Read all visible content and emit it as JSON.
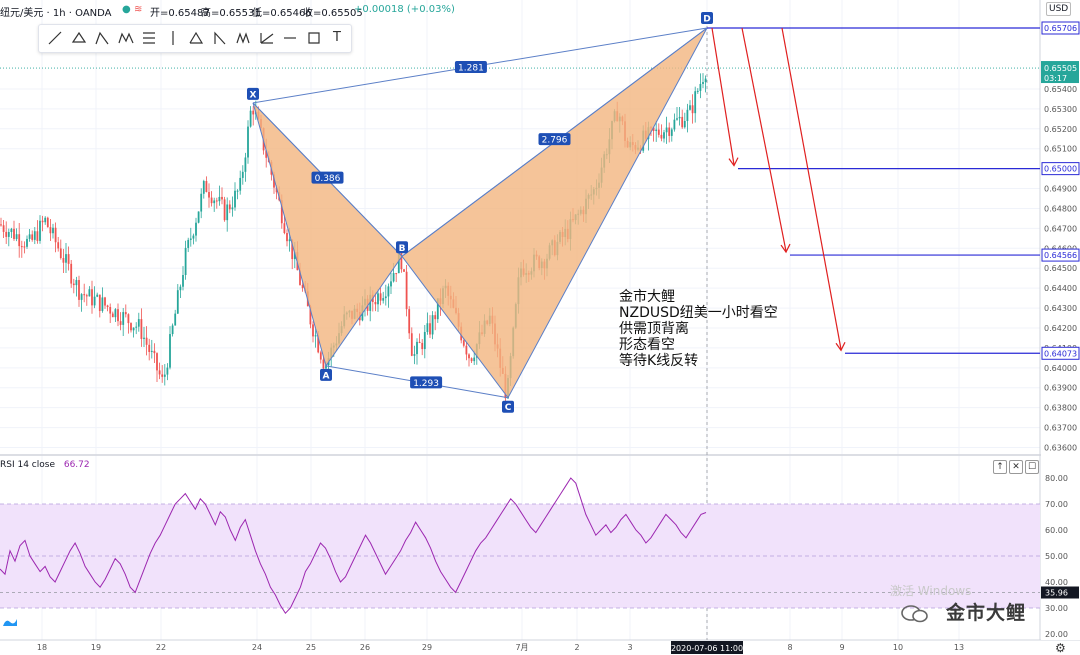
{
  "toolbar": {
    "symbol": "纽元/美元 · 1h · OANDA",
    "open": "开=0.65487",
    "high": "高=0.65531",
    "low": "低=0.65466",
    "close": "收=0.65505",
    "change": "+0.00018 (+0.03%)"
  },
  "drawing_tools": [
    "line-tool-icon",
    "channel-tool-icon",
    "triangle-pattern-icon",
    "xabcd-pattern-icon",
    "fib-tool-icon",
    "vertical-line-icon",
    "fib-extension-icon",
    "triangle-icon",
    "zigzag-icon",
    "gann-icon",
    "horizontal-ray-icon",
    "rectangle-icon",
    "text-tool-icon"
  ],
  "text_tool_label": "T",
  "currency_label": "USD",
  "annotation": {
    "lines": [
      "金市大鲤",
      "NZDUSD纽美一小时看空",
      "供需顶背离",
      "形态看空",
      "等待K线反转"
    ]
  },
  "rsi_panel": {
    "label": "RSI 14 close",
    "value": "66.72",
    "buttons": [
      "↑",
      "✕",
      "☐"
    ]
  },
  "watermark": {
    "os_text": "激活 Windows",
    "brand": "金市大鲤"
  },
  "colors": {
    "pattern_fill": "#f3b57f",
    "pattern_stroke": "#5b7fc7",
    "label_bg": "#1e4fb5",
    "target_line": "#2a2ad6",
    "arrow": "#e02020",
    "up_candle": "#26a69a",
    "down_candle": "#ef5350",
    "rsi_line": "#9c27b0",
    "rsi_band": "#f1e2fb"
  },
  "chart_data": {
    "type": "candlestick",
    "instrument": "NZDUSD",
    "timeframe": "1h",
    "price_axis": {
      "range": [
        0.6355,
        0.6585
      ],
      "ticks": [
        "0.65400",
        "0.65300",
        "0.65200",
        "0.65100",
        "0.64900",
        "0.64800",
        "0.64700",
        "0.64600",
        "0.64500",
        "0.64400",
        "0.64300",
        "0.64200",
        "0.64100",
        "0.64000",
        "0.63900",
        "0.63800",
        "0.63700",
        "0.63600"
      ],
      "tick_values": [
        0.654,
        0.653,
        0.652,
        0.651,
        0.649,
        0.648,
        0.647,
        0.646,
        0.645,
        0.644,
        0.643,
        0.642,
        0.641,
        0.64,
        0.639,
        0.638,
        0.637,
        0.636
      ],
      "highlighted": [
        {
          "label": "0.65706",
          "value": 0.65706,
          "style": "outline"
        },
        {
          "label": "0.65505",
          "value": 0.65505,
          "style": "current",
          "sublabel": "03:17"
        },
        {
          "label": "0.65000",
          "value": 0.65,
          "style": "outline"
        },
        {
          "label": "0.64566",
          "value": 0.64566,
          "style": "outline"
        },
        {
          "label": "0.64073",
          "value": 0.64073,
          "style": "outline"
        }
      ]
    },
    "time_axis": {
      "labels": [
        "18",
        "19",
        "22",
        "24",
        "25",
        "26",
        "29",
        "7月",
        "2",
        "3",
        "6",
        "8",
        "9",
        "10",
        "13"
      ],
      "highlight": "2020-07-06 11:00"
    },
    "harmonic_pattern": {
      "points": [
        {
          "name": "X",
          "price": 0.6533
        },
        {
          "name": "A",
          "price": 0.6401
        },
        {
          "name": "B",
          "price": 0.6456
        },
        {
          "name": "C",
          "price": 0.6385
        },
        {
          "name": "D",
          "price": 0.65706
        }
      ],
      "ratios": [
        {
          "label": "1.281",
          "between": "X-D"
        },
        {
          "label": "0.386",
          "between": "X-B"
        },
        {
          "label": "2.796",
          "between": "B-D"
        },
        {
          "label": "1.293",
          "between": "A-C"
        }
      ]
    },
    "targets": [
      0.65,
      0.64566,
      0.64073
    ],
    "rsi": {
      "period": 14,
      "current": 66.72,
      "axis_ticks": [
        "80.00",
        "70.00",
        "60.00",
        "50.00",
        "40.00",
        "30.00",
        "20.00"
      ],
      "axis_values": [
        80,
        70,
        60,
        50,
        40,
        30,
        20
      ],
      "marker": "35.96",
      "marker_value": 35.96,
      "overbought": 70,
      "oversold": 30,
      "range": [
        20,
        83
      ],
      "values": [
        45,
        43,
        52,
        48,
        54,
        56,
        50,
        47,
        44,
        46,
        42,
        40,
        44,
        48,
        52,
        55,
        51,
        46,
        43,
        40,
        38,
        41,
        45,
        49,
        47,
        43,
        38,
        36,
        41,
        46,
        51,
        55,
        58,
        62,
        66,
        70,
        72,
        74,
        71,
        68,
        72,
        70,
        66,
        62,
        67,
        65,
        60,
        56,
        61,
        64,
        58,
        52,
        47,
        43,
        38,
        35,
        31,
        28,
        30,
        34,
        38,
        44,
        47,
        51,
        55,
        53,
        49,
        44,
        40,
        42,
        46,
        50,
        54,
        58,
        55,
        51,
        47,
        43,
        46,
        49,
        52,
        56,
        59,
        63,
        60,
        57,
        53,
        48,
        44,
        41,
        38,
        36,
        40,
        44,
        48,
        52,
        55,
        57,
        60,
        63,
        66,
        69,
        72,
        70,
        67,
        64,
        61,
        59,
        62,
        65,
        68,
        71,
        74,
        77,
        80,
        78,
        72,
        66,
        62,
        58,
        60,
        62,
        59,
        61,
        64,
        66,
        63,
        60,
        58,
        55,
        57,
        60,
        63,
        66,
        64,
        62,
        59,
        57,
        60,
        63,
        66,
        66.72
      ]
    }
  }
}
